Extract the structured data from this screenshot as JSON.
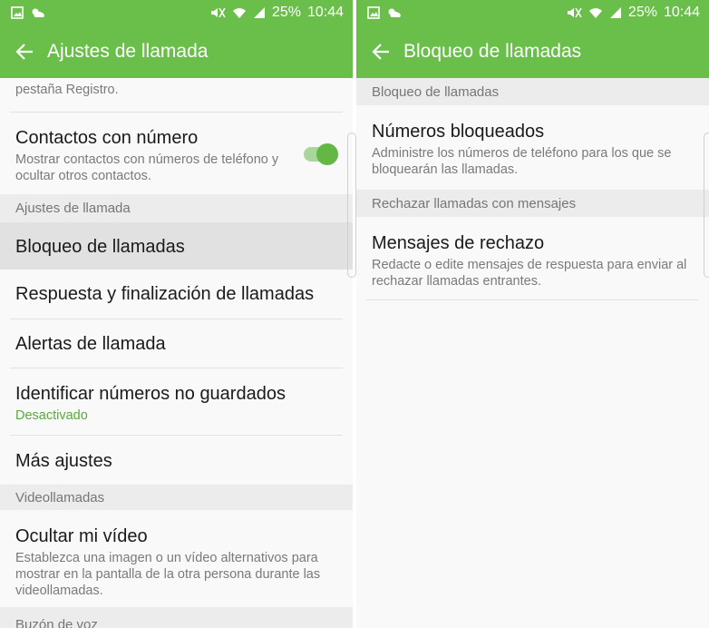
{
  "status": {
    "battery": "25%",
    "time": "10:44"
  },
  "left": {
    "title": "Ajustes de llamada",
    "clipped_text": "pestaña Registro.",
    "contacts": {
      "title": "Contactos con número",
      "sub": "Mostrar contactos con números de teléfono y ocultar otros contactos.",
      "toggle_on": true
    },
    "sections": {
      "call_settings": "Ajustes de llamada",
      "video_calls": "Videollamadas",
      "voicemail": "Buzón de voz"
    },
    "items": {
      "block": "Bloqueo de llamadas",
      "answer": "Respuesta y finalización de llamadas",
      "alerts": "Alertas de llamada",
      "identify": "Identificar números no guardados",
      "identify_status": "Desactivado",
      "more": "Más ajustes",
      "hide_video": "Ocultar mi vídeo",
      "hide_video_sub": "Establezca una imagen o un vídeo alternativos para mostrar en la pantalla de la otra persona durante las videollamadas."
    }
  },
  "right": {
    "title": "Bloqueo de llamadas",
    "section_block": "Bloqueo de llamadas",
    "blocked_title": "Números bloqueados",
    "blocked_sub": "Administre los números de teléfono para los que se bloquearán las llamadas.",
    "section_reject": "Rechazar llamadas con mensajes",
    "reject_title": "Mensajes de rechazo",
    "reject_sub": "Redacte o edite mensajes de respuesta para enviar al rechazar llamadas entrantes."
  },
  "colors": {
    "accent": "#6abf4b",
    "status_green": "#5aa83d"
  }
}
